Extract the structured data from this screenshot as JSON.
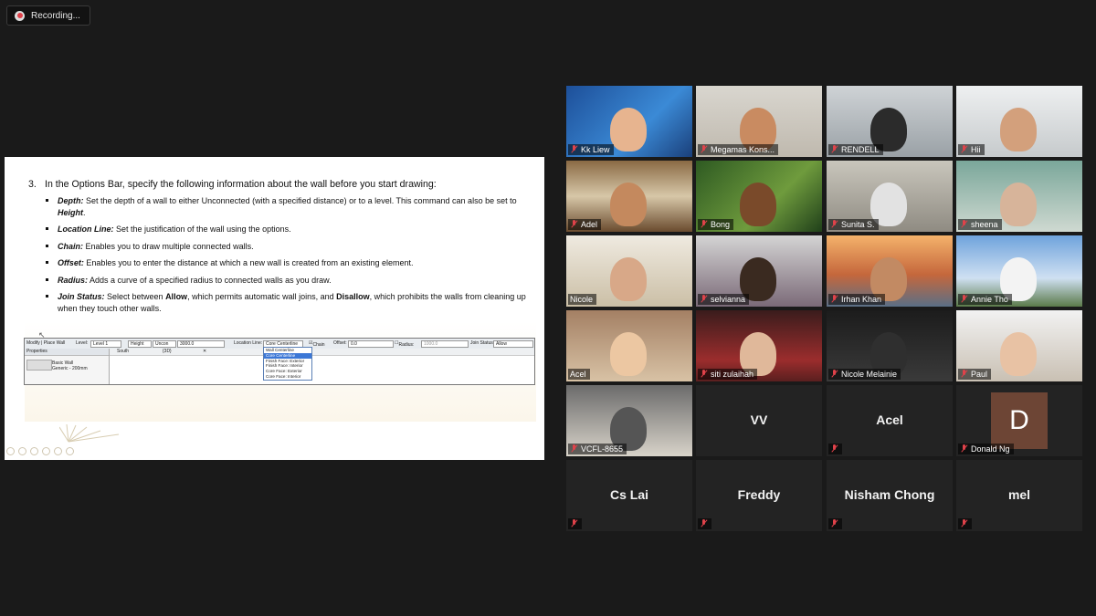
{
  "recording": {
    "label": "Recording..."
  },
  "slide": {
    "step_number": "3.",
    "step_text": "In the Options Bar, specify the following information about the wall before you start drawing:",
    "bullets": [
      {
        "term": "Depth:",
        "text": " Set the depth of a wall to either Unconnected (with a specified distance) or to a level. This command can also be set to ",
        "tail_bold": "Height",
        "tail": "."
      },
      {
        "term": "Location Line:",
        "text": " Set the justification of the wall using the options."
      },
      {
        "term": "Chain:",
        "text": " Enables you to draw multiple connected walls."
      },
      {
        "term": "Offset:",
        "text": " Enables you to enter the distance at which a new wall is created from an existing element."
      },
      {
        "term": "Radius:",
        "text": " Adds a curve of a specified radius to connected walls as you draw."
      },
      {
        "term": "Join Status:",
        "text": " Select between ",
        "b1": "Allow",
        "mid": ", which permits automatic wall joins, and ",
        "b2": "Disallow",
        "end": ", which prohibits the walls from cleaning up when they touch other walls."
      }
    ],
    "revit": {
      "modify_label": "Modify | Place Wall",
      "level_label": "Level:",
      "level_value": "Level 1",
      "height_label": "Height",
      "unconn_value": "Uncon",
      "height_value": "3000.0",
      "location_line_label": "Location Line:",
      "location_line_value": "Core Centerline",
      "chain_label": "Chain",
      "offset_label": "Offset:",
      "offset_value": "0.0",
      "radius_label": "Radius:",
      "radius_value": "1000.0",
      "join_status_label": "Join Status:",
      "join_status_value": "Allow",
      "properties_label": "Properties",
      "type_line1": "Basic Wall",
      "type_line2": "Generic - 200mm",
      "tab_south": "South",
      "tab_3d": "{3D}",
      "dropdown_options": [
        "Wall Centerline",
        "Core Centerline",
        "Finish Face: Exterior",
        "Finish Face: Interior",
        "Core Face: Exterior",
        "Core Face: Interior"
      ],
      "dropdown_selected": "Core Centerline"
    }
  },
  "participants": [
    {
      "name": "Kk Liew",
      "muted": true,
      "video": true
    },
    {
      "name": "Megamas Kons...",
      "muted": true,
      "video": true
    },
    {
      "name": "RENDELL",
      "muted": true,
      "video": true
    },
    {
      "name": "Hii",
      "muted": true,
      "video": true
    },
    {
      "name": "Adel",
      "muted": true,
      "video": true
    },
    {
      "name": "Bong",
      "muted": true,
      "video": true
    },
    {
      "name": "Sunita S.",
      "muted": true,
      "video": true
    },
    {
      "name": "sheena",
      "muted": true,
      "video": true
    },
    {
      "name": "Nicole",
      "muted": false,
      "video": true,
      "active": true
    },
    {
      "name": "selvianna",
      "muted": true,
      "video": true
    },
    {
      "name": "Irhan Khan",
      "muted": true,
      "video": true
    },
    {
      "name": "Annie Tho",
      "muted": true,
      "video": true
    },
    {
      "name": "Acel",
      "muted": false,
      "video": true
    },
    {
      "name": "siti zulaihah",
      "muted": true,
      "video": true
    },
    {
      "name": "Nicole Melainie",
      "muted": true,
      "video": true
    },
    {
      "name": "Paul",
      "muted": true,
      "video": true
    },
    {
      "name": "VCFL-8655",
      "muted": true,
      "video": true
    },
    {
      "name": "VV",
      "muted": false,
      "video": false
    },
    {
      "name": "Acel",
      "muted": true,
      "video": false
    },
    {
      "name": "Donald Ng",
      "muted": true,
      "video": false,
      "avatar_letter": "D"
    },
    {
      "name": "Cs Lai",
      "muted": true,
      "video": false
    },
    {
      "name": "Freddy",
      "muted": true,
      "video": false
    },
    {
      "name": "Nisham Chong",
      "muted": true,
      "video": false
    },
    {
      "name": "mel",
      "muted": true,
      "video": false
    }
  ],
  "colors": {
    "active_speaker": "#c7df6a",
    "mute": "#e0424a",
    "avatar_d": "#6d4535"
  }
}
